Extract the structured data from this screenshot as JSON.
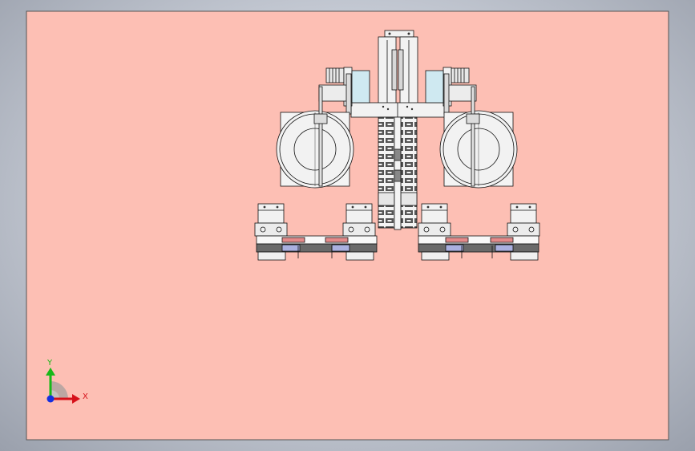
{
  "viewport": {
    "sheet_color": "#fdbfb4",
    "part_fill": "#f2f2f2",
    "part_stroke": "#111111",
    "accent_blue": "#cfe9f1",
    "accent_red": "#e58a8a",
    "accent_lavender": "#aab0e0",
    "dark_fill": "#4b4b4b"
  },
  "triad": {
    "x_label": "X",
    "y_label": "Y",
    "x_color": "#d6101a",
    "y_color": "#18b818",
    "z_color": "#1430e0"
  }
}
